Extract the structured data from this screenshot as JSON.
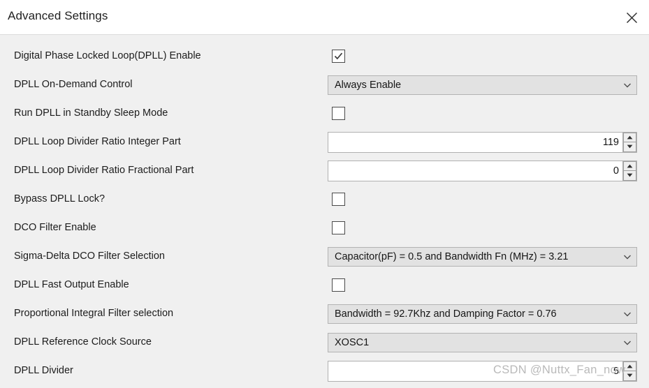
{
  "window": {
    "title": "Advanced Settings",
    "close_icon": "close-icon"
  },
  "colors": {
    "background": "#f0f0f0",
    "titlebar": "#ffffff",
    "combo_fill": "#e2e2e2",
    "combo_border": "#b3b3b3",
    "input_fill": "#ffffff",
    "text": "#1c1c1c",
    "watermark": "#b9b9b9"
  },
  "watermark": {
    "text": "CSDN @Nuttx_Fan_now"
  },
  "settings": {
    "rows": [
      {
        "label": "Digital Phase Locked Loop(DPLL) Enable",
        "control": "checkbox",
        "checked": true,
        "name": "dpll-enable"
      },
      {
        "label": "DPLL On-Demand Control",
        "control": "combo",
        "value": "Always Enable",
        "name": "dpll-on-demand-control"
      },
      {
        "label": "Run DPLL in Standby Sleep Mode",
        "control": "checkbox",
        "checked": false,
        "name": "run-dpll-standby-sleep"
      },
      {
        "label": "DPLL Loop Divider Ratio Integer Part",
        "control": "spin",
        "value": "119",
        "name": "dpll-loop-divider-integer"
      },
      {
        "label": "DPLL Loop Divider Ratio Fractional Part",
        "control": "spin",
        "value": "0",
        "name": "dpll-loop-divider-fractional"
      },
      {
        "label": "Bypass DPLL Lock?",
        "control": "checkbox",
        "checked": false,
        "name": "bypass-dpll-lock"
      },
      {
        "label": "DCO Filter Enable",
        "control": "checkbox",
        "checked": false,
        "name": "dco-filter-enable"
      },
      {
        "label": "Sigma-Delta DCO Filter Selection",
        "control": "combo",
        "value": "Capacitor(pF) = 0.5 and Bandwidth Fn (MHz) = 3.21",
        "name": "sigma-delta-dco-filter-selection"
      },
      {
        "label": "DPLL Fast Output Enable",
        "control": "checkbox",
        "checked": false,
        "name": "dpll-fast-output-enable"
      },
      {
        "label": "Proportional Integral Filter selection",
        "control": "combo",
        "value": "Bandwidth = 92.7Khz and Damping Factor = 0.76",
        "name": "proportional-integral-filter-selection"
      },
      {
        "label": "DPLL Reference Clock Source",
        "control": "combo",
        "value": "XOSC1",
        "name": "dpll-reference-clock-source"
      },
      {
        "label": "DPLL Divider",
        "control": "spin",
        "value": "5",
        "name": "dpll-divider"
      }
    ]
  }
}
